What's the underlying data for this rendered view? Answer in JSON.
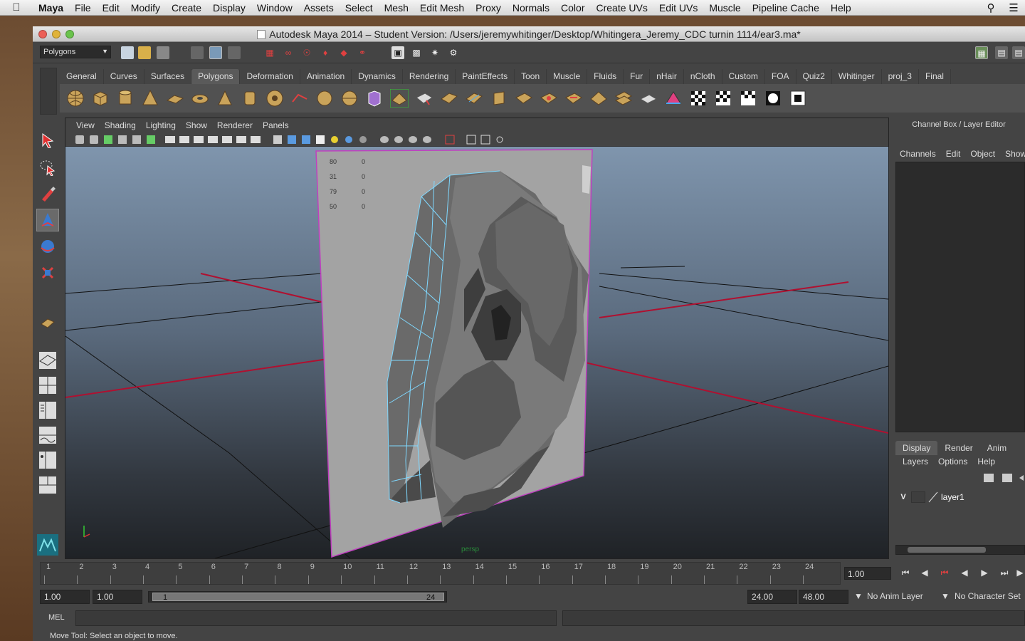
{
  "menubar": {
    "apple": "",
    "items": [
      "Maya",
      "File",
      "Edit",
      "Modify",
      "Create",
      "Display",
      "Window",
      "Assets",
      "Select",
      "Mesh",
      "Edit Mesh",
      "Proxy",
      "Normals",
      "Color",
      "Create UVs",
      "Edit UVs",
      "Muscle",
      "Pipeline Cache",
      "Help"
    ]
  },
  "window": {
    "title": "Autodesk Maya 2014 – Student Version: /Users/jeremywhitinger/Desktop/Whitingera_Jeremy_CDC turnin 1114/ear3.ma*"
  },
  "statusline": {
    "mode": "Polygons"
  },
  "shelf": {
    "tabs": [
      "General",
      "Curves",
      "Surfaces",
      "Polygons",
      "Deformation",
      "Animation",
      "Dynamics",
      "Rendering",
      "PaintEffects",
      "Toon",
      "Muscle",
      "Fluids",
      "Fur",
      "nHair",
      "nCloth",
      "Custom",
      "FOA",
      "Quiz2",
      "Whitinger",
      "proj_3",
      "Final"
    ],
    "active_tab": "Polygons"
  },
  "viewport": {
    "menu": [
      "View",
      "Shading",
      "Lighting",
      "Show",
      "Renderer",
      "Panels"
    ],
    "camera_label": "persp",
    "image_plane_text": {
      "col_a": [
        "80",
        "31",
        "79",
        "50"
      ],
      "col_b": [
        "0",
        "0",
        "0",
        "0"
      ]
    }
  },
  "channel_box": {
    "title": "Channel Box / Layer Editor",
    "menu": [
      "Channels",
      "Edit",
      "Object",
      "Show"
    ],
    "layer_tabs": [
      "Display",
      "Render",
      "Anim"
    ],
    "active_layer_tab": "Display",
    "layer_menu": [
      "Layers",
      "Options",
      "Help"
    ],
    "layers": [
      {
        "visible": "V",
        "name": "layer1"
      }
    ]
  },
  "timeline": {
    "ticks": [
      "1",
      "2",
      "3",
      "4",
      "5",
      "6",
      "7",
      "8",
      "9",
      "10",
      "11",
      "12",
      "13",
      "14",
      "15",
      "16",
      "17",
      "18",
      "19",
      "20",
      "21",
      "22",
      "23",
      "24"
    ],
    "current_frame": "1.00"
  },
  "range": {
    "start": "1.00",
    "playback_start": "1.00",
    "slider_low": "1",
    "slider_high": "24",
    "playback_end": "24.00",
    "end": "48.00",
    "anim_layer": "No Anim Layer",
    "character_set": "No Character Set"
  },
  "command": {
    "label": "MEL"
  },
  "helpline": {
    "text": "Move Tool: Select an object to move."
  },
  "colors": {
    "ui_bg": "#444444",
    "grid_axis": "#c0163c",
    "wire": "#7fd8ff"
  }
}
